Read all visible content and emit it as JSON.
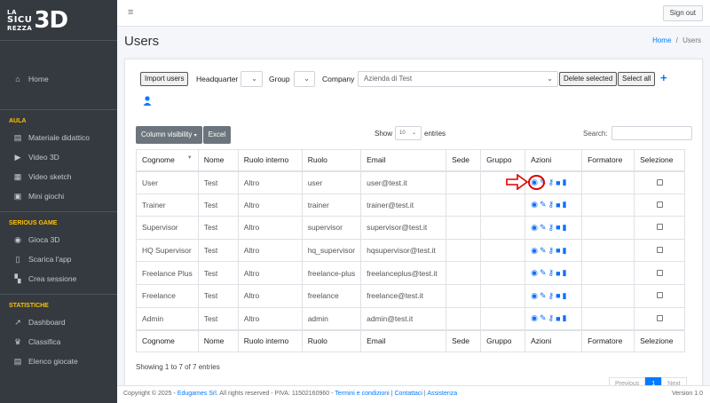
{
  "brand": {
    "line1": "LA",
    "line2": "SICU",
    "line3": "REZZA",
    "big": "3D"
  },
  "sidebar": {
    "home": "Home",
    "section_aula": "AULA",
    "aula_items": [
      "Materiale didattico",
      "Video 3D",
      "Video sketch",
      "Mini giochi"
    ],
    "section_serious": "SERIOUS GAME",
    "serious_items": [
      "Gioca 3D",
      "Scarica l'app",
      "Crea sessione"
    ],
    "section_stats": "STATISTICHE",
    "stats_items": [
      "Dashboard",
      "Classifica",
      "Elenco giocate"
    ]
  },
  "topbar": {
    "menu_icon": "hamburger-icon",
    "signout": "Sign out"
  },
  "page": {
    "title": "Users",
    "breadcrumb_home": "Home",
    "breadcrumb_sep": "/",
    "breadcrumb_current": "Users"
  },
  "filters": {
    "import_users": "Import users",
    "headquarter_label": "Headquarter",
    "headquarter_value": "",
    "group_label": "Group",
    "group_value": "",
    "company_label": "Company",
    "company_value": "Azienda di Test",
    "delete_selected": "Delete selected",
    "select_all": "Select all",
    "add_icon": "plus-icon",
    "user_icon": "user-icon"
  },
  "table_controls": {
    "column_visibility": "Column visibility",
    "excel": "Excel",
    "show_label": "Show",
    "show_value": "10",
    "entries_label": "entries",
    "search_label": "Search:",
    "search_value": ""
  },
  "table": {
    "headers": [
      "Cognome",
      "Nome",
      "Ruolo interno",
      "Ruolo",
      "Email",
      "Sede",
      "Gruppo",
      "Azioni",
      "Formatore",
      "Selezione"
    ],
    "rows": [
      [
        "User",
        "Test",
        "Altro",
        "user",
        "user@test.it",
        "",
        "",
        "",
        "",
        ""
      ],
      [
        "Trainer",
        "Test",
        "Altro",
        "trainer",
        "trainer@test.it",
        "",
        "",
        "",
        "",
        ""
      ],
      [
        "Supervisor",
        "Test",
        "Altro",
        "supervisor",
        "supervisor@test.it",
        "",
        "",
        "",
        "",
        ""
      ],
      [
        "HQ Supervisor",
        "Test",
        "Altro",
        "hq_supervisor",
        "hqsupervisor@test.it",
        "",
        "",
        "",
        "",
        ""
      ],
      [
        "Freelance Plus",
        "Test",
        "Altro",
        "freelance-plus",
        "freelanceplus@test.it",
        "",
        "",
        "",
        "",
        ""
      ],
      [
        "Freelance",
        "Test",
        "Altro",
        "freelance",
        "freelance@test.it",
        "",
        "",
        "",
        "",
        ""
      ],
      [
        "Admin",
        "Test",
        "Altro",
        "admin",
        "admin@test.it",
        "",
        "",
        "",
        "",
        ""
      ]
    ],
    "action_icons": [
      "eye-icon",
      "pencil-icon",
      "key-icon",
      "lock-icon",
      "trash-icon"
    ]
  },
  "table_info": "Showing 1 to 7 of 7 entries",
  "pagination": {
    "previous": "Previous",
    "page": "1",
    "next": "Next"
  },
  "footer": {
    "copyright": "Copyright © 2025 - ",
    "company": "Edugames Srl",
    "rights": ". All rights reserved - PIVA: 11502160960 - ",
    "terms": "Termini e condizioni",
    "sep1": " | ",
    "contacts": "Contattaci",
    "sep2": " | ",
    "support": "Assistenza",
    "version": "Version 1.0"
  },
  "colors": {
    "sidebar": "#343a40",
    "accent": "#007bff",
    "section": "#ffc107",
    "annotation": "#e00000"
  }
}
